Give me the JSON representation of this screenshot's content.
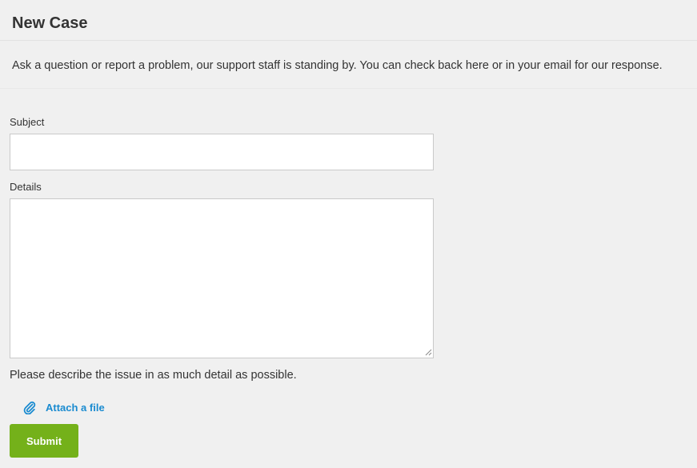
{
  "header": {
    "title": "New Case"
  },
  "intro": {
    "text": "Ask a question or report a problem, our support staff is standing by. You can check back here or in your email for our response."
  },
  "form": {
    "subject": {
      "label": "Subject",
      "value": "",
      "placeholder": ""
    },
    "details": {
      "label": "Details",
      "value": "",
      "placeholder": "",
      "help_text": "Please describe the issue in as much detail as possible."
    },
    "attach": {
      "label": "Attach a file",
      "icon": "paperclip-icon"
    },
    "submit": {
      "label": "Submit"
    }
  },
  "colors": {
    "background": "#f0f0f0",
    "text": "#333333",
    "link": "#1a8bd0",
    "submit_button": "#74b11a",
    "submit_text": "#ffffff",
    "input_border": "#c9c9c9"
  }
}
